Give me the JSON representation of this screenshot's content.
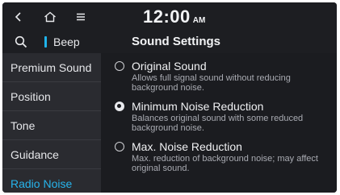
{
  "topbar": {
    "back_icon": "chevron-left-icon",
    "home_icon": "home-icon",
    "menu_icon": "menu-icon",
    "time": "12:00",
    "ampm": "AM"
  },
  "subbar": {
    "search_icon": "search-icon",
    "beep_label": "Beep",
    "title": "Sound Settings"
  },
  "sidebar": {
    "items": [
      {
        "label": "Premium Sound"
      },
      {
        "label": "Position"
      },
      {
        "label": "Tone"
      },
      {
        "label": "Guidance"
      },
      {
        "label": "Radio Noise",
        "selected": true
      }
    ]
  },
  "options": [
    {
      "title": "Original Sound",
      "description": "Allows full signal sound without reducing background noise.",
      "selected": false
    },
    {
      "title": "Minimum Noise Reduction",
      "description": "Balances original sound with some reduced background noise.",
      "selected": true
    },
    {
      "title": "Max. Noise Reduction",
      "description": "Max. reduction of background noise; may affect original sound.",
      "selected": false
    }
  ],
  "colors": {
    "accent": "#27b4ec",
    "background": "#1b1c20",
    "sidebar": "#2a2b30"
  }
}
